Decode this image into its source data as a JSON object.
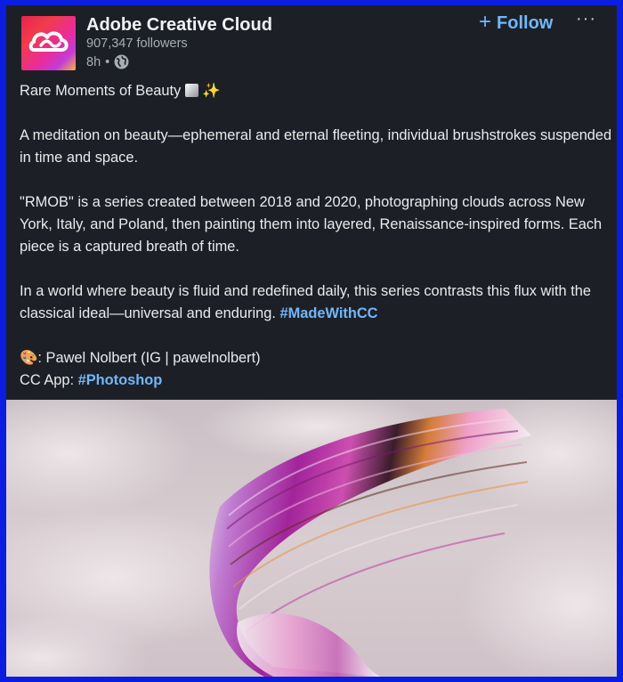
{
  "post": {
    "company_name": "Adobe Creative Cloud",
    "followers": "907,347 followers",
    "age": "8h",
    "separator": "•",
    "follow_label": "Follow",
    "follow_icon": "+",
    "more_label": "···",
    "title_line": "Rare Moments of Beauty",
    "paragraph1": "A meditation on beauty—ephemeral and eternal fleeting, individual brushstrokes suspended in time and space.",
    "paragraph2": "\"RMOB\" is a series created between 2018 and 2020, photographing clouds across New York, Italy, and Poland, then painting them into layered, Renaissance-inspired forms. Each piece is a captured breath of time.",
    "paragraph3": "In a world where beauty is fluid and redefined daily, this series contrasts this flux with the classical ideal—universal and enduring.",
    "hashtag1": "#MadeWithCC",
    "credit": ": Pawel Nolbert (IG | pawelnolbert)",
    "app_line": "CC App: ",
    "hashtag2": "#Photoshop",
    "sparkle_emoji": "✨",
    "palette_emoji": "🎨"
  },
  "colors": {
    "card_bg": "#1c2026",
    "link": "#71b7fb",
    "frame": "#0b1de0"
  },
  "icons": {
    "logo": "adobe-creative-cloud-logo",
    "visibility": "globe-icon",
    "more": "more-dots-icon",
    "follow": "plus-icon"
  }
}
